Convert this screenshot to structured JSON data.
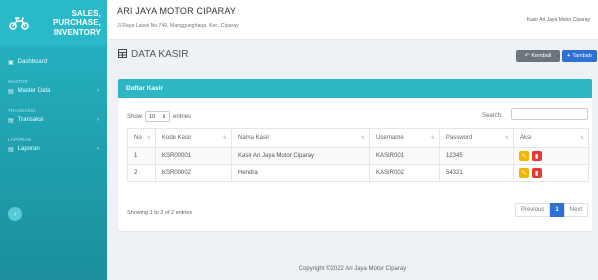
{
  "brand": {
    "line1": "SALES,",
    "line2": "PURCHASE,",
    "line3": "INVENTORY",
    "logo_icon": "motorcycle-icon"
  },
  "sidebar": {
    "dashboard": {
      "label": "Dashboard",
      "icon": "dashboard-icon"
    },
    "headers": {
      "master": "MASTER",
      "transaksi": "TRANSAKSI",
      "laporan": "LAPORAN"
    },
    "master_data": {
      "label": "Master Data",
      "icon": "database-icon"
    },
    "transaksi": {
      "label": "Transaksi",
      "icon": "file-icon"
    },
    "laporan": {
      "label": "Laporan",
      "icon": "report-icon"
    },
    "toggle_icon": "chevron-left-icon"
  },
  "topbar": {
    "store_name": "ARI JAYA MOTOR CIPARAY",
    "store_address": "Jl.Raya Laswi No.749, Manggungharja, Kec. Ciparay",
    "user_name": "Kasir Ari Jaya Motor Ciparay"
  },
  "page": {
    "title": "DATA KASIR",
    "back_label": "Kembali",
    "add_label": "Tambah"
  },
  "card": {
    "title": "Daftar Kasir",
    "show_label": "Show",
    "entries_value": "10",
    "entries_label": "entries",
    "search_label": "Search:",
    "search_value": ""
  },
  "table": {
    "columns": [
      "No",
      "Kode Kasir",
      "Nama Kasir",
      "Username",
      "Password",
      "Aksi"
    ],
    "rows": [
      {
        "no": "1",
        "kode": "KSR00001",
        "nama": "Kasir Ari Jaya Motor Ciparay",
        "username": "KASIR001",
        "password": "12345"
      },
      {
        "no": "2",
        "kode": "KSR00002",
        "nama": "Hendra",
        "username": "KASIR002",
        "password": "54321"
      }
    ],
    "info": "Showing 1 to 2 of 2 entries"
  },
  "pagination": {
    "previous": "Previous",
    "current": "1",
    "next": "Next"
  },
  "footer": {
    "copyright": "Copyright ©2022 Ari Jaya Motor Ciparay"
  },
  "colors": {
    "accent": "#2fb6c5",
    "primary": "#2f6fd6",
    "secondary": "#6c757d",
    "edit": "#f4b400",
    "delete": "#e53935"
  }
}
